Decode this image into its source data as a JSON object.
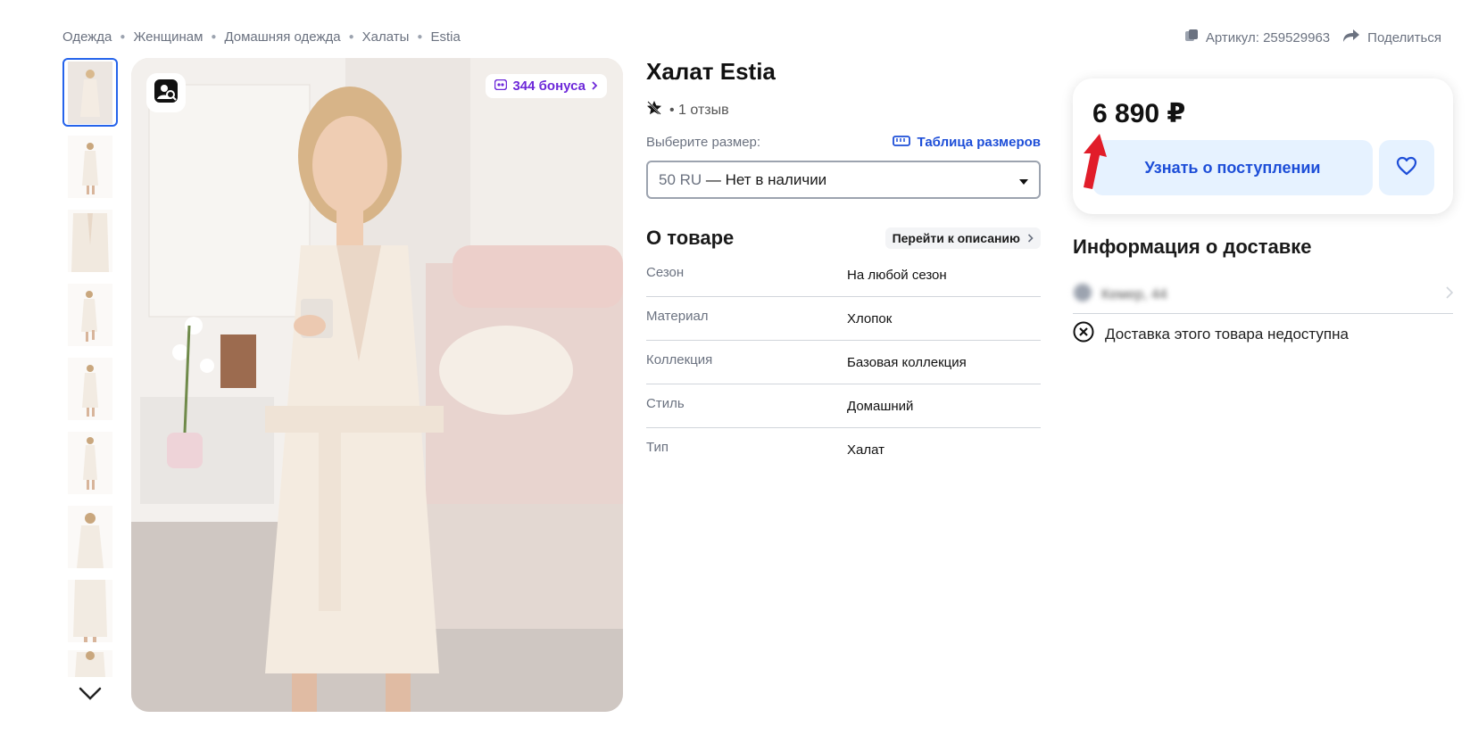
{
  "breadcrumb": [
    "Одежда",
    "Женщинам",
    "Домашняя одежда",
    "Халаты",
    "Estia"
  ],
  "header": {
    "article_label": "Артикул: 259529963",
    "share_label": "Поделиться"
  },
  "gallery": {
    "bonus_label": "344 бонуса",
    "thumb_count": 9
  },
  "product": {
    "title": "Халат Estia",
    "reviews": "• 1 отзыв",
    "size_prompt": "Выберите размер:",
    "size_table_label": "Таблица размеров",
    "selected_size": "50 RU",
    "selected_size_status": "— Нет в наличии",
    "about_title": "О товаре",
    "goto_description": "Перейти к описанию",
    "specs": [
      {
        "key": "Сезон",
        "value": "На любой сезон"
      },
      {
        "key": "Материал",
        "value": "Хлопок"
      },
      {
        "key": "Коллекция",
        "value": "Базовая коллекция"
      },
      {
        "key": "Стиль",
        "value": "Домашний"
      },
      {
        "key": "Тип",
        "value": "Халат"
      }
    ]
  },
  "buy": {
    "price": "6 890 ₽",
    "notify_label": "Узнать о поступлении"
  },
  "delivery": {
    "title": "Информация о доставке",
    "address": "Кемер, 44",
    "unavailable": "Доставка этого товара недоступна"
  },
  "colors": {
    "accent": "#1d4ed8",
    "bonus": "#6d28d9",
    "button_bg": "#e6f2ff",
    "arrow": "#e11d2a"
  }
}
